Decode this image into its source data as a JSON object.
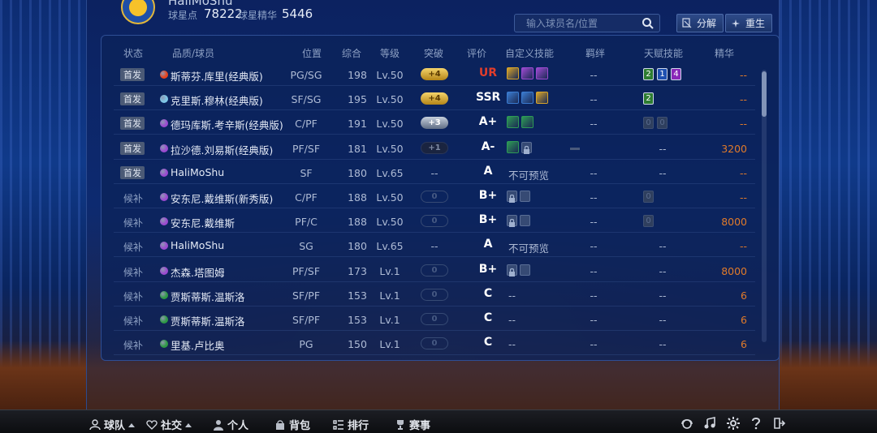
{
  "header": {
    "team_name": "HaliMoShu",
    "star_points_label": "球星点",
    "star_points": "78222",
    "star_essence_label": "球星精华",
    "star_essence": "5446",
    "search_placeholder": "输入球员名/位置",
    "decompose_label": "分解",
    "rebirth_label": "重生"
  },
  "columns": [
    "状态",
    "品质/球员",
    "位置",
    "综合",
    "等级",
    "突破",
    "评价",
    "自定义技能",
    "羁绊",
    "天赋技能",
    "精华"
  ],
  "rows": [
    {
      "status": "首发",
      "starter": true,
      "quality_color": "#e8421c",
      "name": "斯蒂芬.库里(经典版)",
      "position": "PG/SG",
      "overall": "198",
      "level": "Lv.50",
      "breakthrough": "+4",
      "bt_style": "gold",
      "grade": "UR",
      "grade_color": "#e23d2b",
      "skills": [
        "#d8a42a",
        "#9b4ad0",
        "#9b4ad0"
      ],
      "locks": 0,
      "skill_text": "",
      "bond": "--",
      "talents": [
        {
          "v": "2",
          "c": "#2e7d32"
        },
        {
          "v": "1",
          "c": "#1e50b0"
        },
        {
          "v": "4",
          "c": "#8a28b8"
        }
      ],
      "talent_text": "",
      "essence": "--",
      "essence_color": "#e07a2a"
    },
    {
      "status": "首发",
      "starter": true,
      "quality_color": "#7ec8e8",
      "name": "克里斯.穆林(经典版)",
      "position": "SF/SG",
      "overall": "195",
      "level": "Lv.50",
      "breakthrough": "+4",
      "bt_style": "gold",
      "grade": "SSR",
      "grade_color": "#ffffff",
      "skills": [
        "#3a7bd0",
        "#3a7bd0",
        "#d8a42a"
      ],
      "locks": 0,
      "skill_text": "",
      "bond": "--",
      "talents": [
        {
          "v": "2",
          "c": "#2e7d32"
        }
      ],
      "talent_text": "",
      "essence": "--",
      "essence_color": "#e07a2a"
    },
    {
      "status": "首发",
      "starter": true,
      "quality_color": "#9b4ad0",
      "name": "德玛库斯.考辛斯(经典版)",
      "position": "C/PF",
      "overall": "191",
      "level": "Lv.50",
      "breakthrough": "+3",
      "bt_style": "silver",
      "grade": "A+",
      "grade_color": "#ffffff",
      "skills": [
        "#2e9a55",
        "#2e9a55"
      ],
      "locks": 0,
      "skill_text": "",
      "bond": "--",
      "talents": [
        {
          "v": "0",
          "c": "#2f3f5e"
        },
        {
          "v": "0",
          "c": "#2f3f5e"
        }
      ],
      "talent_text": "",
      "essence": "--",
      "essence_color": "#e07a2a"
    },
    {
      "status": "首发",
      "starter": true,
      "quality_color": "#9b4ad0",
      "name": "拉沙德.刘易斯(经典版)",
      "position": "PF/SF",
      "overall": "181",
      "level": "Lv.50",
      "breakthrough": "+1",
      "bt_style": "dark",
      "grade": "A-",
      "grade_color": "#ffffff",
      "skills": [
        "#2e9a55"
      ],
      "locks": 1,
      "skill_text": "",
      "bond": "",
      "talents": [],
      "talent_text": "--",
      "essence": "3200",
      "essence_color": "#e07a2a"
    },
    {
      "status": "首发",
      "starter": true,
      "quality_color": "#9b4ad0",
      "name": "HaliMoShu",
      "position": "SF",
      "overall": "180",
      "level": "Lv.65",
      "breakthrough": "--",
      "bt_style": "none",
      "grade": "A",
      "grade_color": "#ffffff",
      "skills": [],
      "locks": 0,
      "skill_text": "不可预览",
      "bond": "--",
      "talents": [],
      "talent_text": "--",
      "essence": "--",
      "essence_color": "#e07a2a"
    },
    {
      "status": "候补",
      "starter": false,
      "quality_color": "#9b4ad0",
      "name": "安东尼.戴维斯(新秀版)",
      "position": "C/PF",
      "overall": "188",
      "level": "Lv.50",
      "breakthrough": "0",
      "bt_style": "empty",
      "grade": "B+",
      "grade_color": "#ffffff",
      "skills": [],
      "locks": 2,
      "skill_text": "",
      "bond": "--",
      "talents": [
        {
          "v": "0",
          "c": "#2f3f5e"
        }
      ],
      "talent_text": "",
      "essence": "--",
      "essence_color": "#e07a2a"
    },
    {
      "status": "候补",
      "starter": false,
      "quality_color": "#9b4ad0",
      "name": "安东尼.戴维斯",
      "position": "PF/C",
      "overall": "188",
      "level": "Lv.50",
      "breakthrough": "0",
      "bt_style": "empty",
      "grade": "B+",
      "grade_color": "#ffffff",
      "skills": [],
      "locks": 2,
      "skill_text": "",
      "bond": "--",
      "talents": [
        {
          "v": "0",
          "c": "#2f3f5e"
        }
      ],
      "talent_text": "",
      "essence": "8000",
      "essence_color": "#e07a2a"
    },
    {
      "status": "候补",
      "starter": false,
      "quality_color": "#9b4ad0",
      "name": "HaliMoShu",
      "position": "SG",
      "overall": "180",
      "level": "Lv.65",
      "breakthrough": "--",
      "bt_style": "none",
      "grade": "A",
      "grade_color": "#ffffff",
      "skills": [],
      "locks": 0,
      "skill_text": "不可预览",
      "bond": "--",
      "talents": [],
      "talent_text": "--",
      "essence": "--",
      "essence_color": "#e07a2a"
    },
    {
      "status": "候补",
      "starter": false,
      "quality_color": "#9b4ad0",
      "name": "杰森.塔图姆",
      "position": "PF/SF",
      "overall": "173",
      "level": "Lv.1",
      "breakthrough": "0",
      "bt_style": "empty",
      "grade": "B+",
      "grade_color": "#ffffff",
      "skills": [],
      "locks": 2,
      "skill_text": "",
      "bond": "--",
      "talents": [],
      "talent_text": "--",
      "essence": "8000",
      "essence_color": "#e07a2a"
    },
    {
      "status": "候补",
      "starter": false,
      "quality_color": "#2e9a45",
      "name": "贾斯蒂斯.温斯洛",
      "position": "SF/PF",
      "overall": "153",
      "level": "Lv.1",
      "breakthrough": "0",
      "bt_style": "empty",
      "grade": "C",
      "grade_color": "#ffffff",
      "skills": [],
      "locks": 0,
      "skill_text": "--",
      "bond": "--",
      "talents": [],
      "talent_text": "--",
      "essence": "6",
      "essence_color": "#e07a2a"
    },
    {
      "status": "候补",
      "starter": false,
      "quality_color": "#2e9a45",
      "name": "贾斯蒂斯.温斯洛",
      "position": "SF/PF",
      "overall": "153",
      "level": "Lv.1",
      "breakthrough": "0",
      "bt_style": "empty",
      "grade": "C",
      "grade_color": "#ffffff",
      "skills": [],
      "locks": 0,
      "skill_text": "--",
      "bond": "--",
      "talents": [],
      "talent_text": "--",
      "essence": "6",
      "essence_color": "#e07a2a"
    },
    {
      "status": "候补",
      "starter": false,
      "quality_color": "#2e9a45",
      "name": "里基.卢比奥",
      "position": "PG",
      "overall": "150",
      "level": "Lv.1",
      "breakthrough": "0",
      "bt_style": "empty",
      "grade": "C",
      "grade_color": "#ffffff",
      "skills": [],
      "locks": 0,
      "skill_text": "--",
      "bond": "--",
      "talents": [],
      "talent_text": "--",
      "essence": "6",
      "essence_color": "#e07a2a"
    }
  ],
  "bottom_nav": {
    "team": "球队",
    "social": "社交",
    "personal": "个人",
    "bag": "背包",
    "ranking": "排行",
    "events": "赛事"
  }
}
